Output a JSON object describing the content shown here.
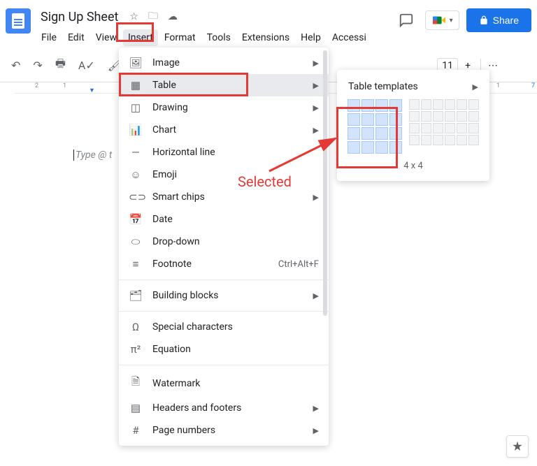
{
  "doc": {
    "title": "Sign Up Sheet",
    "placeholder": "Type @ t"
  },
  "menubar": [
    "File",
    "Edit",
    "View",
    "Insert",
    "Format",
    "Tools",
    "Extensions",
    "Help",
    "Accessi"
  ],
  "active_menu_index": 3,
  "header": {
    "share_label": "Share"
  },
  "toolbar": {
    "font_size": "11"
  },
  "ruler": {
    "marks": [
      "2",
      "1",
      "1",
      "7"
    ]
  },
  "dropdown": {
    "items": [
      {
        "icon": "🖼",
        "label": "Image",
        "arrow": true
      },
      {
        "icon": "▦",
        "label": "Table",
        "arrow": true,
        "highlighted": true
      },
      {
        "icon": "◫",
        "label": "Drawing",
        "arrow": true
      },
      {
        "icon": "📊",
        "label": "Chart",
        "arrow": true
      },
      {
        "icon": "—",
        "label": "Horizontal line"
      },
      {
        "icon": "☺",
        "label": "Emoji"
      },
      {
        "icon": "⊂⊃",
        "label": "Smart chips",
        "arrow": true
      },
      {
        "icon": "📅",
        "label": "Date"
      },
      {
        "icon": "⬭",
        "label": "Drop-down"
      },
      {
        "icon": "≡",
        "label": "Footnote",
        "shortcut": "Ctrl+Alt+F"
      },
      {
        "sep": true
      },
      {
        "icon": "🗂",
        "label": "Building blocks",
        "arrow": true
      },
      {
        "sep": true
      },
      {
        "icon": "Ω",
        "label": "Special characters"
      },
      {
        "icon": "π²",
        "label": "Equation"
      },
      {
        "sep": true
      },
      {
        "icon": "🗎",
        "label": "Watermark"
      },
      {
        "icon": "▤",
        "label": "Headers and footers",
        "arrow": true
      },
      {
        "icon": "#",
        "label": "Page numbers",
        "arrow": true
      }
    ]
  },
  "submenu": {
    "title": "Table templates",
    "selected_size": "4 x 4",
    "selected_rows": 4,
    "selected_cols": 4
  },
  "annotation": {
    "label": "Selected"
  }
}
